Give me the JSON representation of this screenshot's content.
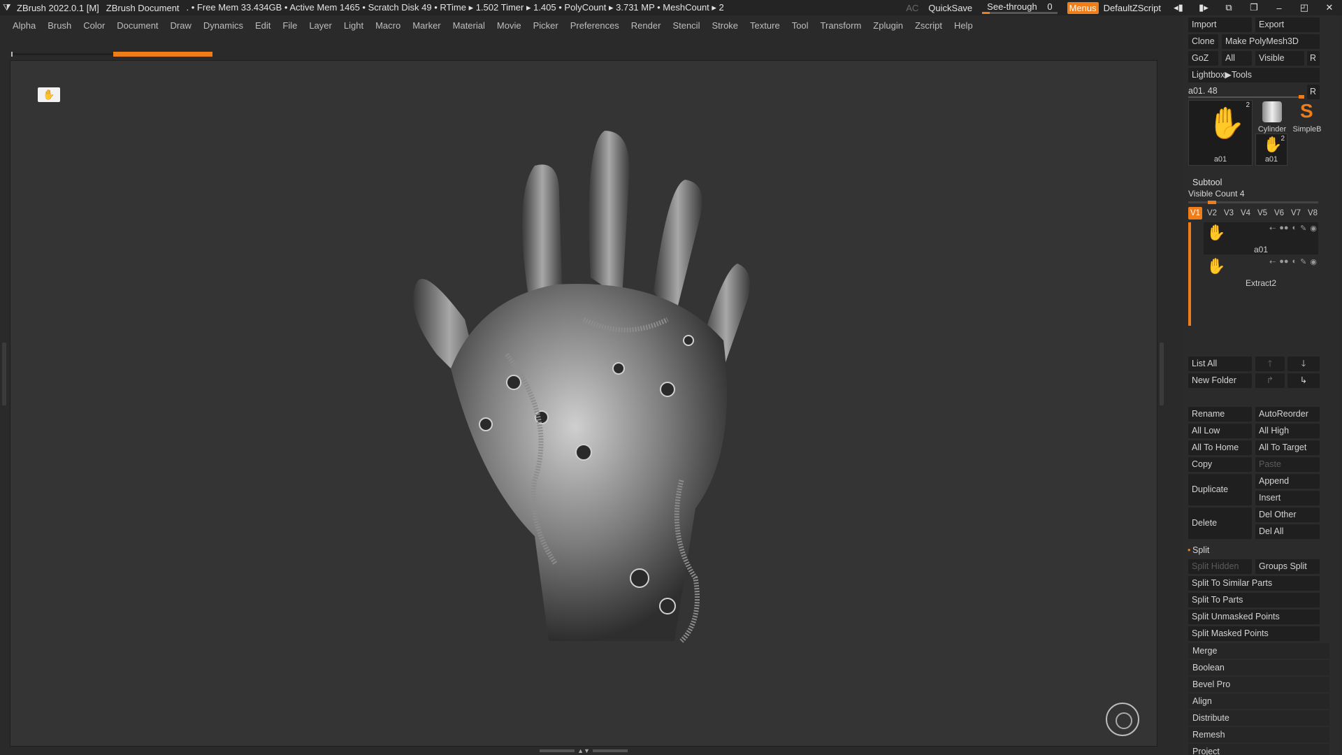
{
  "titlebar": {
    "app_title": "ZBrush 2022.0.1 [M]",
    "document": "ZBrush Document",
    "stats": ". • Free Mem 33.434GB • Active Mem 1465 • Scratch Disk 49 • RTime ▸ 1.502 Timer ▸ 1.405 • PolyCount ▸ 3.731 MP • MeshCount ▸ 2",
    "ac": "AC",
    "quicksave": "QuickSave",
    "seethrough_label": "See-through",
    "seethrough_value": "0",
    "menus": "Menus",
    "zscript": "DefaultZScript"
  },
  "menubar": [
    "Alpha",
    "Brush",
    "Color",
    "Document",
    "Draw",
    "Dynamics",
    "Edit",
    "File",
    "Layer",
    "Light",
    "Macro",
    "Marker",
    "Material",
    "Movie",
    "Picker",
    "Preferences",
    "Render",
    "Stencil",
    "Stroke",
    "Texture",
    "Tool",
    "Transform",
    "Zplugin",
    "Zscript",
    "Help"
  ],
  "tool_panel": {
    "import": "Import",
    "export": "Export",
    "clone": "Clone",
    "make_polymesh": "Make PolyMesh3D",
    "goz": "GoZ",
    "all": "All",
    "visible": "Visible",
    "r": "R",
    "lightbox": "Lightbox▶Tools",
    "current_tool": "a01. 48",
    "thumb_a01": "a01",
    "thumb_a01_count": "2",
    "thumb_cylinder": "Cylinder",
    "thumb_simpleb": "SimpleB",
    "thumb_a01_small": "a01",
    "thumb_a01_small_count": "2"
  },
  "subtool": {
    "title": "Subtool",
    "visible_count": "Visible Count 4",
    "tabs": [
      "V1",
      "V2",
      "V3",
      "V4",
      "V5",
      "V6",
      "V7",
      "V8"
    ],
    "items": [
      {
        "name": "a01"
      },
      {
        "name": "Extract2"
      }
    ],
    "list_all": "List All",
    "new_folder": "New Folder",
    "rename": "Rename",
    "autoreorder": "AutoReorder",
    "all_low": "All Low",
    "all_high": "All High",
    "all_to_home": "All To Home",
    "all_to_target": "All To Target",
    "copy": "Copy",
    "paste": "Paste",
    "duplicate": "Duplicate",
    "append": "Append",
    "insert": "Insert",
    "delete": "Delete",
    "del_other": "Del Other",
    "del_all": "Del All"
  },
  "split": {
    "title": "Split",
    "split_hidden": "Split Hidden",
    "groups_split": "Groups Split",
    "similar": "Split To Similar Parts",
    "parts": "Split To Parts",
    "unmasked": "Split Unmasked Points",
    "masked": "Split Masked Points"
  },
  "sections": [
    "Merge",
    "Boolean",
    "Bevel Pro",
    "Align",
    "Distribute",
    "Remesh",
    "Project"
  ]
}
